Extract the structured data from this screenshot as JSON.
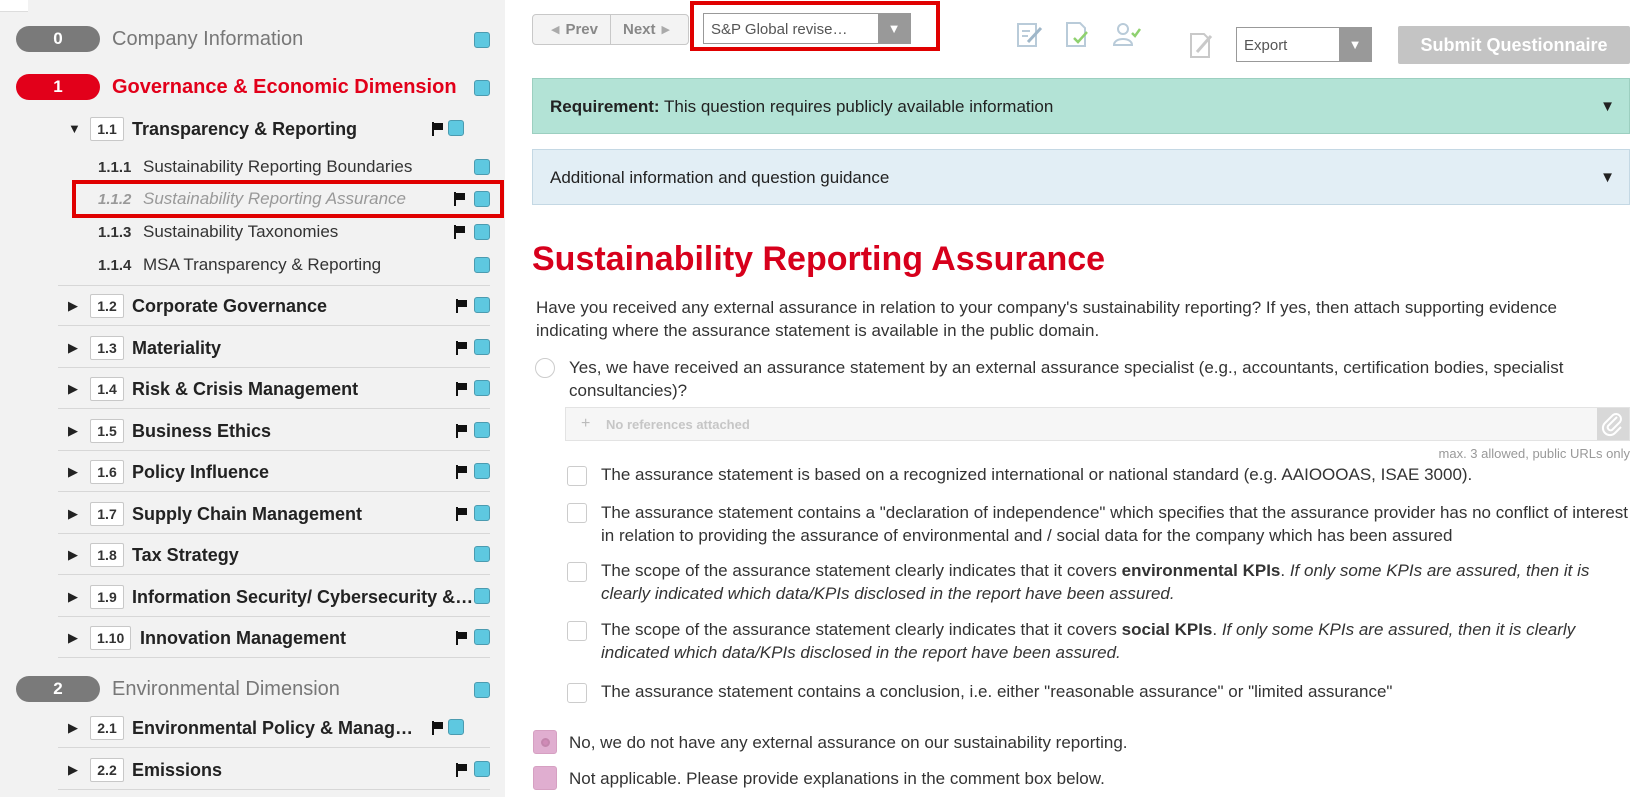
{
  "sidebar": {
    "dimensions": [
      {
        "num": "0",
        "title": "Company Information",
        "color": "#7a7a7a",
        "title_color": "#777777"
      },
      {
        "num": "1",
        "title": "Governance & Economic Dimension",
        "color": "#e2001a",
        "title_color": "#e2001a"
      },
      {
        "num": "2",
        "title": "Environmental Dimension",
        "color": "#7a7a7a",
        "title_color": "#777777"
      }
    ],
    "sections": [
      {
        "num": "1.1",
        "title": "Transparency & Reporting",
        "expanded": true,
        "flag": true
      },
      {
        "num": "1.2",
        "title": "Corporate Governance",
        "flag": true
      },
      {
        "num": "1.3",
        "title": "Materiality",
        "flag": true
      },
      {
        "num": "1.4",
        "title": "Risk & Crisis Management",
        "flag": true
      },
      {
        "num": "1.5",
        "title": "Business Ethics",
        "flag": true
      },
      {
        "num": "1.6",
        "title": "Policy Influence",
        "flag": true
      },
      {
        "num": "1.7",
        "title": "Supply Chain Management",
        "flag": true
      },
      {
        "num": "1.8",
        "title": "Tax Strategy",
        "flag": false
      },
      {
        "num": "1.9",
        "title": "Information Security/ Cybersecurity &…",
        "flag": false
      },
      {
        "num": "1.10",
        "title": "Innovation Management",
        "flag": true
      },
      {
        "num": "2.1",
        "title": "Environmental Policy & Manag…",
        "flag": true
      },
      {
        "num": "2.2",
        "title": "Emissions",
        "flag": true
      }
    ],
    "subsections": [
      {
        "num": "1.1.1",
        "title": "Sustainability Reporting Boundaries",
        "flag": false
      },
      {
        "num": "1.1.2",
        "title": "Sustainability Reporting Assurance",
        "flag": true,
        "active": true
      },
      {
        "num": "1.1.3",
        "title": "Sustainability Taxonomies",
        "flag": true
      },
      {
        "num": "1.1.4",
        "title": "MSA Transparency & Reporting",
        "flag": false
      }
    ]
  },
  "toolbar": {
    "prev_label": "Prev",
    "next_label": "Next",
    "version_select": "S&P Global revise…",
    "export_select": "Export",
    "submit_label": "Submit Questionnaire",
    "icons": [
      "edit-note-icon",
      "document-check-icon",
      "user-check-icon",
      "edit-document-icon"
    ]
  },
  "panels": {
    "requirement_label": "Requirement:",
    "requirement_text": "This question requires publicly available information",
    "guidance_text": "Additional information and question guidance"
  },
  "question": {
    "title": "Sustainability Reporting Assurance",
    "text": "Have you received any external assurance in relation to your company's sustainability reporting? If yes, then attach supporting evidence indicating where the assurance statement is available in the public domain.",
    "option_yes": "Yes, we have received an assurance statement by an external assurance specialist (e.g., accountants, certification bodies, specialist consultancies)?",
    "references_placeholder": "No references attached",
    "references_hint": "max. 3 allowed, public URLs only",
    "checks": [
      {
        "text": "The assurance statement is based on a recognized international or national standard (e.g. AAIOOOAS, ISAE 3000)."
      },
      {
        "text": "The assurance statement contains a \"declaration of independence\" which specifies that the assurance provider has no conflict of interest in relation to providing the assurance of environmental and / social data for the company which has been assured"
      },
      {
        "pre": "The scope of the assurance statement clearly indicates that it covers ",
        "bold": "environmental KPIs",
        "post": ". ",
        "italic": "If only some KPIs are assured, then it is clearly indicated which data/KPIs disclosed in the report have been assured."
      },
      {
        "pre": "The scope of the assurance statement clearly indicates that it covers ",
        "bold": "social KPIs",
        "post": ". ",
        "italic": "If only some KPIs are assured, then it is clearly indicated which data/KPIs disclosed in the report have been assured."
      },
      {
        "text": "The assurance statement contains a conclusion, i.e. either \"reasonable assurance\" or \"limited assurance\""
      }
    ],
    "option_no": "No, we do not have any external assurance on our sustainability reporting.",
    "option_na": "Not applicable. Please provide explanations in the comment box below."
  }
}
